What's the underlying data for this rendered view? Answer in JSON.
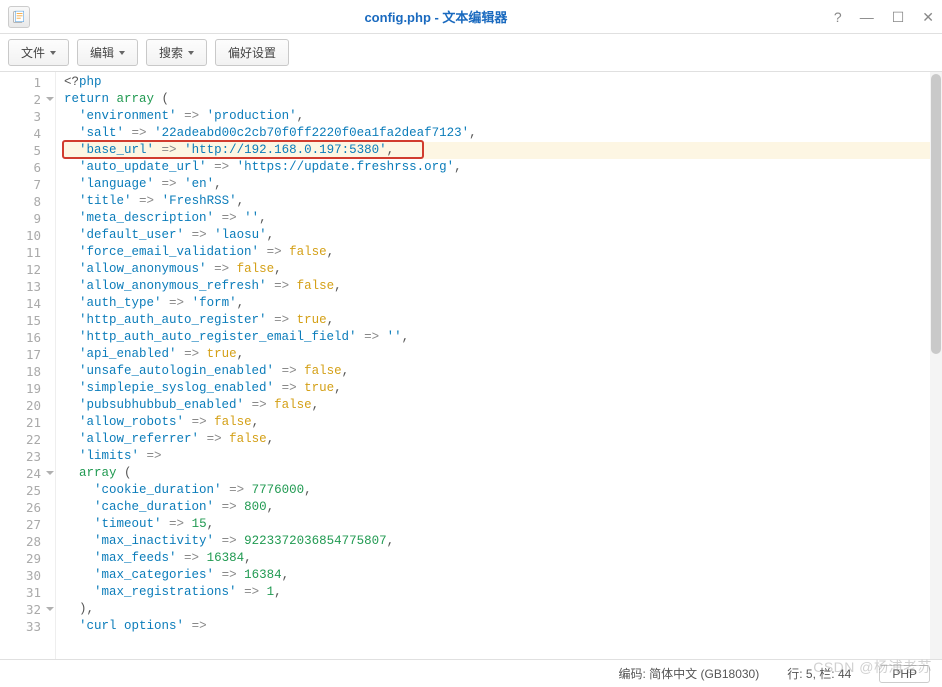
{
  "window": {
    "title": "config.php - 文本编辑器"
  },
  "toolbar": {
    "file": "文件",
    "edit": "编辑",
    "search": "搜索",
    "prefs": "偏好设置"
  },
  "editor": {
    "highlighted_line": 5,
    "lines": [
      {
        "n": 1,
        "indent": 0,
        "rtn": false,
        "tokens": [
          [
            "t",
            "<?"
          ],
          [
            "k",
            "php"
          ]
        ]
      },
      {
        "n": 2,
        "indent": 0,
        "rtn": true,
        "tokens": [
          [
            "k",
            "return"
          ],
          [
            "t",
            " "
          ],
          [
            "kr",
            "array"
          ],
          [
            "t",
            " ("
          ]
        ]
      },
      {
        "n": 3,
        "indent": 1,
        "rtn": false,
        "tokens": [
          [
            "s",
            "'environment'"
          ],
          [
            "t",
            " "
          ],
          [
            "op",
            "=>"
          ],
          [
            "t",
            " "
          ],
          [
            "s",
            "'production'"
          ],
          [
            "t",
            ","
          ]
        ]
      },
      {
        "n": 4,
        "indent": 1,
        "rtn": false,
        "tokens": [
          [
            "s",
            "'salt'"
          ],
          [
            "t",
            " "
          ],
          [
            "op",
            "=>"
          ],
          [
            "t",
            " "
          ],
          [
            "s",
            "'22adeabd00c2cb70f0ff2220f0ea1fa2deaf7123'"
          ],
          [
            "t",
            ","
          ]
        ]
      },
      {
        "n": 5,
        "indent": 1,
        "rtn": false,
        "hl": true,
        "tokens": [
          [
            "s",
            "'base_url'"
          ],
          [
            "t",
            " "
          ],
          [
            "op",
            "=>"
          ],
          [
            "t",
            " "
          ],
          [
            "s",
            "'http://192.168.0.197:5380'"
          ],
          [
            "t",
            ","
          ]
        ]
      },
      {
        "n": 6,
        "indent": 1,
        "rtn": false,
        "tokens": [
          [
            "s",
            "'auto_update_url'"
          ],
          [
            "t",
            " "
          ],
          [
            "op",
            "=>"
          ],
          [
            "t",
            " "
          ],
          [
            "s",
            "'https://update.freshrss.org'"
          ],
          [
            "t",
            ","
          ]
        ]
      },
      {
        "n": 7,
        "indent": 1,
        "rtn": false,
        "tokens": [
          [
            "s",
            "'language'"
          ],
          [
            "t",
            " "
          ],
          [
            "op",
            "=>"
          ],
          [
            "t",
            " "
          ],
          [
            "s",
            "'en'"
          ],
          [
            "t",
            ","
          ]
        ]
      },
      {
        "n": 8,
        "indent": 1,
        "rtn": false,
        "tokens": [
          [
            "s",
            "'title'"
          ],
          [
            "t",
            " "
          ],
          [
            "op",
            "=>"
          ],
          [
            "t",
            " "
          ],
          [
            "s",
            "'FreshRSS'"
          ],
          [
            "t",
            ","
          ]
        ]
      },
      {
        "n": 9,
        "indent": 1,
        "rtn": false,
        "tokens": [
          [
            "s",
            "'meta_description'"
          ],
          [
            "t",
            " "
          ],
          [
            "op",
            "=>"
          ],
          [
            "t",
            " "
          ],
          [
            "s",
            "''"
          ],
          [
            "t",
            ","
          ]
        ]
      },
      {
        "n": 10,
        "indent": 1,
        "rtn": false,
        "tokens": [
          [
            "s",
            "'default_user'"
          ],
          [
            "t",
            " "
          ],
          [
            "op",
            "=>"
          ],
          [
            "t",
            " "
          ],
          [
            "s",
            "'laosu'"
          ],
          [
            "t",
            ","
          ]
        ]
      },
      {
        "n": 11,
        "indent": 1,
        "rtn": false,
        "tokens": [
          [
            "s",
            "'force_email_validation'"
          ],
          [
            "t",
            " "
          ],
          [
            "op",
            "=>"
          ],
          [
            "t",
            " "
          ],
          [
            "p",
            "false"
          ],
          [
            "t",
            ","
          ]
        ]
      },
      {
        "n": 12,
        "indent": 1,
        "rtn": false,
        "tokens": [
          [
            "s",
            "'allow_anonymous'"
          ],
          [
            "t",
            " "
          ],
          [
            "op",
            "=>"
          ],
          [
            "t",
            " "
          ],
          [
            "p",
            "false"
          ],
          [
            "t",
            ","
          ]
        ]
      },
      {
        "n": 13,
        "indent": 1,
        "rtn": false,
        "tokens": [
          [
            "s",
            "'allow_anonymous_refresh'"
          ],
          [
            "t",
            " "
          ],
          [
            "op",
            "=>"
          ],
          [
            "t",
            " "
          ],
          [
            "p",
            "false"
          ],
          [
            "t",
            ","
          ]
        ]
      },
      {
        "n": 14,
        "indent": 1,
        "rtn": false,
        "tokens": [
          [
            "s",
            "'auth_type'"
          ],
          [
            "t",
            " "
          ],
          [
            "op",
            "=>"
          ],
          [
            "t",
            " "
          ],
          [
            "s",
            "'form'"
          ],
          [
            "t",
            ","
          ]
        ]
      },
      {
        "n": 15,
        "indent": 1,
        "rtn": false,
        "tokens": [
          [
            "s",
            "'http_auth_auto_register'"
          ],
          [
            "t",
            " "
          ],
          [
            "op",
            "=>"
          ],
          [
            "t",
            " "
          ],
          [
            "p",
            "true"
          ],
          [
            "t",
            ","
          ]
        ]
      },
      {
        "n": 16,
        "indent": 1,
        "rtn": false,
        "tokens": [
          [
            "s",
            "'http_auth_auto_register_email_field'"
          ],
          [
            "t",
            " "
          ],
          [
            "op",
            "=>"
          ],
          [
            "t",
            " "
          ],
          [
            "s",
            "''"
          ],
          [
            "t",
            ","
          ]
        ]
      },
      {
        "n": 17,
        "indent": 1,
        "rtn": false,
        "tokens": [
          [
            "s",
            "'api_enabled'"
          ],
          [
            "t",
            " "
          ],
          [
            "op",
            "=>"
          ],
          [
            "t",
            " "
          ],
          [
            "p",
            "true"
          ],
          [
            "t",
            ","
          ]
        ]
      },
      {
        "n": 18,
        "indent": 1,
        "rtn": false,
        "tokens": [
          [
            "s",
            "'unsafe_autologin_enabled'"
          ],
          [
            "t",
            " "
          ],
          [
            "op",
            "=>"
          ],
          [
            "t",
            " "
          ],
          [
            "p",
            "false"
          ],
          [
            "t",
            ","
          ]
        ]
      },
      {
        "n": 19,
        "indent": 1,
        "rtn": false,
        "tokens": [
          [
            "s",
            "'simplepie_syslog_enabled'"
          ],
          [
            "t",
            " "
          ],
          [
            "op",
            "=>"
          ],
          [
            "t",
            " "
          ],
          [
            "p",
            "true"
          ],
          [
            "t",
            ","
          ]
        ]
      },
      {
        "n": 20,
        "indent": 1,
        "rtn": false,
        "tokens": [
          [
            "s",
            "'pubsubhubbub_enabled'"
          ],
          [
            "t",
            " "
          ],
          [
            "op",
            "=>"
          ],
          [
            "t",
            " "
          ],
          [
            "p",
            "false"
          ],
          [
            "t",
            ","
          ]
        ]
      },
      {
        "n": 21,
        "indent": 1,
        "rtn": false,
        "tokens": [
          [
            "s",
            "'allow_robots'"
          ],
          [
            "t",
            " "
          ],
          [
            "op",
            "=>"
          ],
          [
            "t",
            " "
          ],
          [
            "p",
            "false"
          ],
          [
            "t",
            ","
          ]
        ]
      },
      {
        "n": 22,
        "indent": 1,
        "rtn": false,
        "tokens": [
          [
            "s",
            "'allow_referrer'"
          ],
          [
            "t",
            " "
          ],
          [
            "op",
            "=>"
          ],
          [
            "t",
            " "
          ],
          [
            "p",
            "false"
          ],
          [
            "t",
            ","
          ]
        ]
      },
      {
        "n": 23,
        "indent": 1,
        "rtn": false,
        "tokens": [
          [
            "s",
            "'limits'"
          ],
          [
            "t",
            " "
          ],
          [
            "op",
            "=>"
          ]
        ]
      },
      {
        "n": 24,
        "indent": 1,
        "rtn": true,
        "tokens": [
          [
            "kr",
            "array"
          ],
          [
            "t",
            " ("
          ]
        ]
      },
      {
        "n": 25,
        "indent": 2,
        "rtn": false,
        "tokens": [
          [
            "s",
            "'cookie_duration'"
          ],
          [
            "t",
            " "
          ],
          [
            "op",
            "=>"
          ],
          [
            "t",
            " "
          ],
          [
            "n",
            "7776000"
          ],
          [
            "t",
            ","
          ]
        ]
      },
      {
        "n": 26,
        "indent": 2,
        "rtn": false,
        "tokens": [
          [
            "s",
            "'cache_duration'"
          ],
          [
            "t",
            " "
          ],
          [
            "op",
            "=>"
          ],
          [
            "t",
            " "
          ],
          [
            "n",
            "800"
          ],
          [
            "t",
            ","
          ]
        ]
      },
      {
        "n": 27,
        "indent": 2,
        "rtn": false,
        "tokens": [
          [
            "s",
            "'timeout'"
          ],
          [
            "t",
            " "
          ],
          [
            "op",
            "=>"
          ],
          [
            "t",
            " "
          ],
          [
            "n",
            "15"
          ],
          [
            "t",
            ","
          ]
        ]
      },
      {
        "n": 28,
        "indent": 2,
        "rtn": false,
        "tokens": [
          [
            "s",
            "'max_inactivity'"
          ],
          [
            "t",
            " "
          ],
          [
            "op",
            "=>"
          ],
          [
            "t",
            " "
          ],
          [
            "n",
            "9223372036854775807"
          ],
          [
            "t",
            ","
          ]
        ]
      },
      {
        "n": 29,
        "indent": 2,
        "rtn": false,
        "tokens": [
          [
            "s",
            "'max_feeds'"
          ],
          [
            "t",
            " "
          ],
          [
            "op",
            "=>"
          ],
          [
            "t",
            " "
          ],
          [
            "n",
            "16384"
          ],
          [
            "t",
            ","
          ]
        ]
      },
      {
        "n": 30,
        "indent": 2,
        "rtn": false,
        "tokens": [
          [
            "s",
            "'max_categories'"
          ],
          [
            "t",
            " "
          ],
          [
            "op",
            "=>"
          ],
          [
            "t",
            " "
          ],
          [
            "n",
            "16384"
          ],
          [
            "t",
            ","
          ]
        ]
      },
      {
        "n": 31,
        "indent": 2,
        "rtn": false,
        "tokens": [
          [
            "s",
            "'max_registrations'"
          ],
          [
            "t",
            " "
          ],
          [
            "op",
            "=>"
          ],
          [
            "t",
            " "
          ],
          [
            "n",
            "1"
          ],
          [
            "t",
            ","
          ]
        ]
      },
      {
        "n": 32,
        "indent": 1,
        "rtn": true,
        "tokens": [
          [
            "t",
            ")"
          ],
          [
            "t",
            ","
          ]
        ]
      },
      {
        "n": 33,
        "indent": 1,
        "rtn": false,
        "tokens": [
          [
            "s",
            "'curl options'"
          ],
          [
            "t",
            " "
          ],
          [
            "op",
            "=>"
          ]
        ]
      }
    ]
  },
  "status": {
    "encoding_label": "编码:",
    "encoding_value": "简体中文 (GB18030)",
    "pos_line_label": "行:",
    "pos_line_value": "5",
    "pos_col_label": "栏:",
    "pos_col_value": "44",
    "lang": "PHP"
  },
  "watermark": "CSDN @杨浦老苏"
}
